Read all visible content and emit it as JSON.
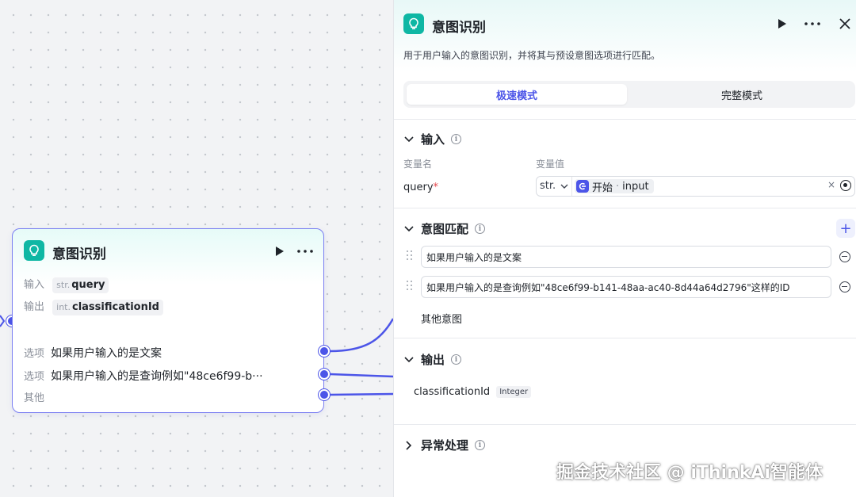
{
  "node": {
    "title": "意图识别",
    "input_label": "输入",
    "input_type": "str.",
    "input_var": "query",
    "output_label": "输出",
    "output_type": "int.",
    "output_var": "classificationId",
    "options": [
      {
        "label": "选项",
        "text": "如果用户输入的是文案"
      },
      {
        "label": "选项",
        "text": "如果用户输入的是查询例如\"48ce6f99-b···"
      },
      {
        "label": "其他",
        "text": ""
      }
    ],
    "colors": {
      "accent": "#4c55e8",
      "border": "#7b7ff2",
      "logo": "#0fb7a4"
    }
  },
  "panel": {
    "title": "意图识别",
    "description": "用于用户输入的意图识别，并将其与预设意图选项进行匹配。",
    "tabs": [
      {
        "label": "极速模式",
        "active": true
      },
      {
        "label": "完整模式",
        "active": false
      }
    ],
    "input_section": {
      "title": "输入",
      "col_name": "变量名",
      "col_value": "变量值",
      "var_name": "query",
      "required_mark": "*",
      "var_type": "str.",
      "ref_source": "开始",
      "ref_sep": " · ",
      "ref_field": "input",
      "clear": "×"
    },
    "intent_section": {
      "title": "意图匹配",
      "add": "+",
      "intents": [
        "如果用户输入的是文案",
        "如果用户输入的是查询例如\"48ce6f99-b141-48aa-ac40-8d44a64d2796\"这样的ID"
      ],
      "other": "其他意图"
    },
    "output_section": {
      "title": "输出",
      "var": "classificationId",
      "type": "Integer"
    },
    "error_section": {
      "title": "异常处理"
    }
  },
  "watermark": "掘金技术社区 @ iThinkAi智能体"
}
